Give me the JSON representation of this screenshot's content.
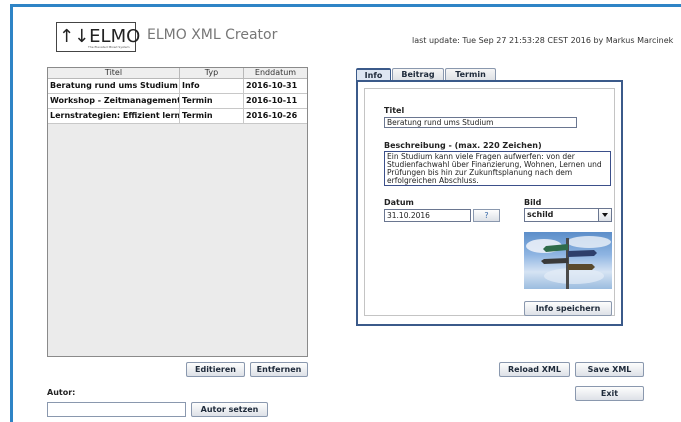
{
  "logo": {
    "text": "↑↓ELMO",
    "subtitle": "The Elevated Mixed System"
  },
  "app_title": "ELMO XML Creator",
  "last_update": "last update: Tue Sep 27 21:53:28 CEST 2016 by Markus Marcinek",
  "table": {
    "columns": [
      "Titel",
      "Typ",
      "Enddatum"
    ],
    "rows": [
      [
        "Beratung rund ums Studium",
        "Info",
        "2016-10-31"
      ],
      [
        "Workshop - Zeitmanagement",
        "Termin",
        "2016-10-11"
      ],
      [
        "Lernstrategien: Effizient lernen...",
        "Termin",
        "2016-10-26"
      ]
    ]
  },
  "list_buttons": {
    "edit": "Editieren",
    "remove": "Entfernen"
  },
  "author": {
    "label": "Autor:",
    "value": "",
    "set_button": "Autor setzen"
  },
  "tabs": [
    {
      "label": "Info",
      "active": true
    },
    {
      "label": "Beitrag",
      "active": false
    },
    {
      "label": "Termin",
      "active": false
    }
  ],
  "info_form": {
    "title_label": "Titel",
    "title_value": "Beratung rund ums Studium",
    "description_label": "Beschreibung - (max. 220 Zeichen)",
    "description_value": "Ein Studium kann viele Fragen aufwerfen: von der Studienfachwahl über Finanzierung, Wohnen, Lernen und Prüfungen bis hin zur Zukunftsplanung nach dem erfolgreichen Abschluss.",
    "date_label": "Datum",
    "date_value": "31.10.2016",
    "date_picker_glyph": "?",
    "image_label": "Bild",
    "image_value": "schild",
    "save_button": "Info speichern"
  },
  "actions": {
    "reload": "Reload XML",
    "save": "Save XML",
    "exit": "Exit"
  },
  "colors": {
    "frame": "#2e84c6",
    "panel_border": "#3b5a8a",
    "button_text": "#1e2a3a"
  },
  "icons": {
    "date_picker": "calendar-icon",
    "dropdown": "chevron-down-icon",
    "image": "signpost-image"
  }
}
